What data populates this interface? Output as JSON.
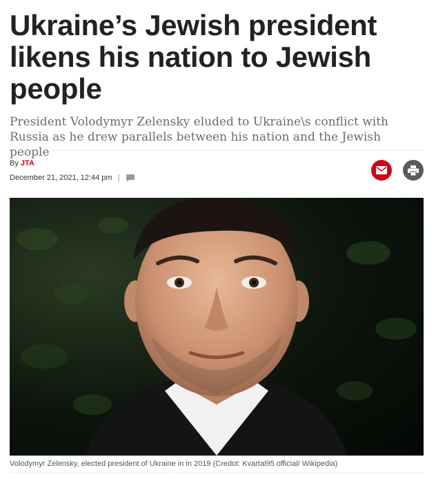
{
  "article": {
    "headline": "Ukraine’s Jewish president likens his nation to Jewish people",
    "subhead": "President Volodymyr Zelensky eluded to Ukraine\\s conflict with Russia as he drew parallels between his nation and the Jewish people",
    "byline_prefix": "By",
    "author": "JTA",
    "date": "December 21, 2021, 12:44 pm",
    "separator": "|",
    "image_caption": "Volodymyr Zelensky, elected president of Ukraine in in 2019 (Credot: Kvartal95 official/ Wikipedia)"
  },
  "icons": {
    "comment": "comment-icon",
    "email": "email-icon",
    "print": "print-icon"
  },
  "colors": {
    "headline": "#222222",
    "subhead": "#6b6b6b",
    "accent": "#d0021b",
    "print_button": "#5a5a5a"
  }
}
